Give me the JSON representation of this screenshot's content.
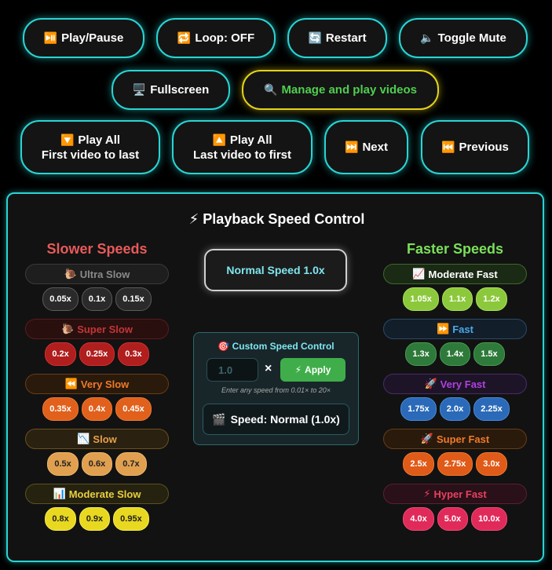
{
  "controls": {
    "play_pause": {
      "icon": "⏯️",
      "label": "Play/Pause"
    },
    "loop": {
      "icon": "🔁",
      "label": "Loop: OFF"
    },
    "restart": {
      "icon": "🔄",
      "label": "Restart"
    },
    "mute": {
      "icon": "🔈",
      "label": "Toggle Mute"
    },
    "fullscreen": {
      "icon": "🖥️",
      "label": "Fullscreen"
    },
    "manage": {
      "icon": "🔍",
      "label": "Manage and play videos"
    },
    "play_all_first": {
      "icon": "🔽",
      "line1": "Play All",
      "line2": "First video to last"
    },
    "play_all_last": {
      "icon": "🔼",
      "line1": "Play All",
      "line2": "Last video to first"
    },
    "next": {
      "icon": "⏭️",
      "label": "Next"
    },
    "previous": {
      "icon": "⏮️",
      "label": "Previous"
    }
  },
  "speed_panel": {
    "title_icon": "⚡",
    "title": "Playback Speed Control",
    "slower_heading": "Slower Speeds",
    "faster_heading": "Faster Speeds",
    "normal_button": "Normal Speed 1.0x",
    "slower_groups": [
      {
        "icon": "🐌",
        "label": "Ultra Slow",
        "color": "#8a8a8a",
        "bg": "#1e1e1e",
        "border": "#3a3a3a",
        "btn_bg": "#2a2a2a",
        "btn_fg": "#ffffff",
        "btn_border": "#5a5a5a",
        "speeds": [
          "0.05x",
          "0.1x",
          "0.15x"
        ]
      },
      {
        "icon": "🐌",
        "label": "Super Slow",
        "color": "#c23636",
        "bg": "#2a0f0f",
        "border": "#5a1c1c",
        "btn_bg": "#b01e1e",
        "btn_fg": "#ffffff",
        "btn_border": "#d43030",
        "speeds": [
          "0.2x",
          "0.25x",
          "0.3x"
        ]
      },
      {
        "icon": "⏪",
        "label": "Very Slow",
        "color": "#f07a2a",
        "bg": "#2a1a0c",
        "border": "#6a3c14",
        "btn_bg": "#e0601c",
        "btn_fg": "#ffffff",
        "btn_border": "#f07a30",
        "speeds": [
          "0.35x",
          "0.4x",
          "0.45x"
        ]
      },
      {
        "icon": "📉",
        "label": "Slow",
        "color": "#e8a04a",
        "bg": "#2a2110",
        "border": "#6a5020",
        "btn_bg": "#e0a050",
        "btn_fg": "#222222",
        "btn_border": "#f0b868",
        "speeds": [
          "0.5x",
          "0.6x",
          "0.7x"
        ]
      },
      {
        "icon": "📊",
        "label": "Moderate Slow",
        "color": "#e8d040",
        "bg": "#262210",
        "border": "#5a5220",
        "btn_bg": "#e8d820",
        "btn_fg": "#222222",
        "btn_border": "#f8ec50",
        "speeds": [
          "0.8x",
          "0.9x",
          "0.95x"
        ]
      }
    ],
    "faster_groups": [
      {
        "icon": "📈",
        "label": "Moderate Fast",
        "color": "#ffffff",
        "bg": "#1a2a14",
        "border": "#3c6a2c",
        "btn_bg": "#8cc83c",
        "btn_fg": "#ffffff",
        "btn_border": "#a8e05a",
        "speeds": [
          "1.05x",
          "1.1x",
          "1.2x"
        ]
      },
      {
        "icon": "⏩",
        "label": "Fast",
        "color": "#4aa8e8",
        "bg": "#121e2a",
        "border": "#2a4a6a",
        "btn_bg": "#2e7a3a",
        "btn_fg": "#ffffff",
        "btn_border": "#4a9a54",
        "speeds": [
          "1.3x",
          "1.4x",
          "1.5x"
        ]
      },
      {
        "icon": "🚀",
        "label": "Very Fast",
        "color": "#b040e0",
        "bg": "#1e1428",
        "border": "#4a2a6a",
        "btn_bg": "#2a6ab8",
        "btn_fg": "#ffffff",
        "btn_border": "#4a8ad8",
        "speeds": [
          "1.75x",
          "2.0x",
          "2.25x"
        ]
      },
      {
        "icon": "🚀",
        "label": "Super Fast",
        "color": "#f07a2a",
        "bg": "#2a1a0c",
        "border": "#6a3c14",
        "btn_bg": "#e05a18",
        "btn_fg": "#ffffff",
        "btn_border": "#f07a30",
        "speeds": [
          "2.5x",
          "2.75x",
          "3.0x"
        ]
      },
      {
        "icon": "⚡",
        "label": "Hyper Fast",
        "color": "#e84060",
        "bg": "#2a1018",
        "border": "#5a2030",
        "btn_bg": "#e02a5a",
        "btn_fg": "#ffffff",
        "btn_border": "#f04a78",
        "speeds": [
          "4.0x",
          "5.0x",
          "10.0x"
        ]
      }
    ],
    "custom": {
      "icon": "🎯",
      "title": "Custom Speed Control",
      "input_value": "1.0",
      "multiply": "×",
      "apply_icon": "⚡",
      "apply_label": "Apply",
      "hint": "Enter any speed from 0.01× to 20×",
      "status_icon": "🎬",
      "status": "Speed: Normal (1.0x)"
    },
    "colors": {
      "slower_heading": "#e85a5a",
      "faster_heading": "#7ae05a",
      "accent": "#2ad4d4"
    }
  }
}
